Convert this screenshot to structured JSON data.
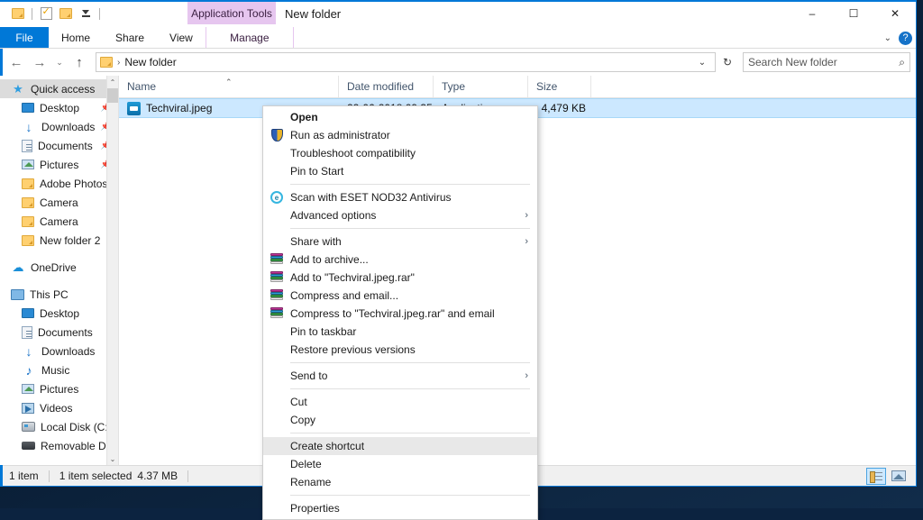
{
  "window": {
    "title": "New folder",
    "app_tools_tab": "Application Tools",
    "minimize": "–",
    "maximize": "☐",
    "close": "✕",
    "ribbon_collapse": "⌄",
    "help": "?"
  },
  "ribbon": {
    "tabs": [
      {
        "label": "File"
      },
      {
        "label": "Home"
      },
      {
        "label": "Share"
      },
      {
        "label": "View"
      },
      {
        "label": "Manage"
      }
    ]
  },
  "addressbar": {
    "back": "←",
    "forward": "→",
    "recent": "⌄",
    "up": "↑",
    "separator": "›",
    "crumb": "New folder",
    "dropdown": "⌄",
    "refresh": "↻"
  },
  "search": {
    "placeholder": "Search New folder",
    "icon": "⌕"
  },
  "sidebar": {
    "scroll_up": "⌃",
    "scroll_down": "⌄",
    "items": [
      {
        "label": "Quick access",
        "icon": "star-icon",
        "selected": true,
        "indent": 0,
        "pinned": false
      },
      {
        "label": "Desktop",
        "icon": "desktop-icon",
        "indent": 1,
        "pinned": true
      },
      {
        "label": "Downloads",
        "icon": "downloads-icon",
        "indent": 1,
        "pinned": true
      },
      {
        "label": "Documents",
        "icon": "documents-icon",
        "indent": 1,
        "pinned": true
      },
      {
        "label": "Pictures",
        "icon": "pictures-icon",
        "indent": 1,
        "pinned": true
      },
      {
        "label": "Adobe Photoshop",
        "icon": "folder-icon",
        "indent": 1,
        "pinned": false
      },
      {
        "label": "Camera",
        "icon": "folder-icon",
        "indent": 1,
        "pinned": false
      },
      {
        "label": "Camera",
        "icon": "folder-icon",
        "indent": 1,
        "pinned": false
      },
      {
        "label": "New folder 2",
        "icon": "folder-icon",
        "indent": 1,
        "pinned": false
      },
      {
        "gap": true
      },
      {
        "label": "OneDrive",
        "icon": "cloud-icon",
        "indent": 0,
        "pinned": false
      },
      {
        "gap": true
      },
      {
        "label": "This PC",
        "icon": "pc-icon",
        "indent": 0,
        "pinned": false
      },
      {
        "label": "Desktop",
        "icon": "desktop-icon",
        "indent": 1,
        "pinned": false
      },
      {
        "label": "Documents",
        "icon": "documents-icon",
        "indent": 1,
        "pinned": false
      },
      {
        "label": "Downloads",
        "icon": "downloads-icon",
        "indent": 1,
        "pinned": false
      },
      {
        "label": "Music",
        "icon": "music-icon",
        "indent": 1,
        "pinned": false
      },
      {
        "label": "Pictures",
        "icon": "pictures-icon",
        "indent": 1,
        "pinned": false
      },
      {
        "label": "Videos",
        "icon": "videos-icon",
        "indent": 1,
        "pinned": false
      },
      {
        "label": "Local Disk (C:)",
        "icon": "disk-icon",
        "indent": 1,
        "pinned": false
      },
      {
        "label": "Removable Disk",
        "icon": "usb-icon",
        "indent": 1,
        "pinned": false
      }
    ]
  },
  "filelist": {
    "columns": [
      {
        "label": "Name",
        "sorted": true,
        "sort_caret": "⌃"
      },
      {
        "label": "Date modified"
      },
      {
        "label": "Type"
      },
      {
        "label": "Size"
      }
    ],
    "rows": [
      {
        "name": "Techviral.jpeg",
        "date_modified": "22-06-2018 09:35",
        "type": "Application",
        "size": "4,479 KB",
        "selected": true,
        "icon": "teamviewer-file-icon"
      }
    ]
  },
  "contextmenu": {
    "submenu_arrow": "›",
    "items": [
      {
        "label": "Open",
        "bold": true,
        "icon": null
      },
      {
        "label": "Run as administrator",
        "icon": "shield-icon"
      },
      {
        "label": "Troubleshoot compatibility",
        "icon": null
      },
      {
        "label": "Pin to Start",
        "icon": null
      },
      {
        "separator": true
      },
      {
        "label": "Scan with ESET NOD32 Antivirus",
        "icon": "eset-icon"
      },
      {
        "label": "Advanced options",
        "icon": null,
        "submenu": true
      },
      {
        "separator": true
      },
      {
        "label": "Share with",
        "icon": null,
        "submenu": true
      },
      {
        "label": "Add to archive...",
        "icon": "winrar-icon"
      },
      {
        "label": "Add to \"Techviral.jpeg.rar\"",
        "icon": "winrar-icon"
      },
      {
        "label": "Compress and email...",
        "icon": "winrar-icon"
      },
      {
        "label": "Compress to \"Techviral.jpeg.rar\" and email",
        "icon": "winrar-icon"
      },
      {
        "label": "Pin to taskbar",
        "icon": null
      },
      {
        "label": "Restore previous versions",
        "icon": null
      },
      {
        "separator": true
      },
      {
        "label": "Send to",
        "icon": null,
        "submenu": true
      },
      {
        "separator": true
      },
      {
        "label": "Cut",
        "icon": null
      },
      {
        "label": "Copy",
        "icon": null
      },
      {
        "separator": true
      },
      {
        "label": "Create shortcut",
        "icon": null,
        "highlighted": true
      },
      {
        "label": "Delete",
        "icon": null
      },
      {
        "label": "Rename",
        "icon": null
      },
      {
        "separator": true
      },
      {
        "label": "Properties",
        "icon": null
      }
    ]
  },
  "statusbar": {
    "item_count": "1 item",
    "selection": "1 item selected",
    "selection_size": "4.37 MB",
    "views": [
      {
        "name": "details-view",
        "active": true
      },
      {
        "name": "large-icons-view",
        "active": false
      }
    ]
  },
  "colors": {
    "accent": "#0078d7",
    "selection": "#cce8ff",
    "app_tools": "#e6c6ef",
    "sidebar_selected": "#dcdcdc"
  }
}
